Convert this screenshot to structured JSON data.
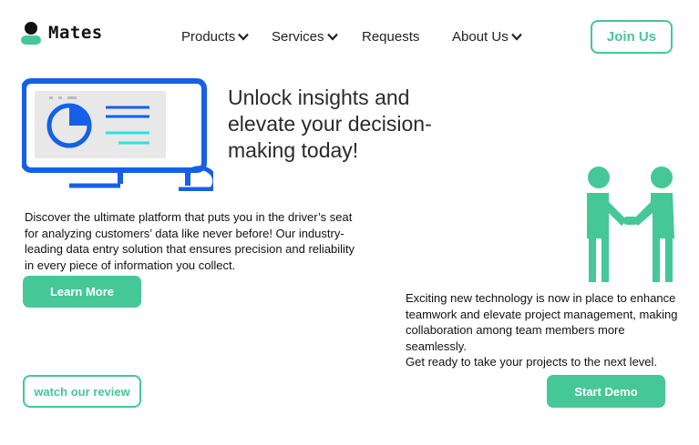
{
  "brand": {
    "name": "Mates",
    "accent": "#45c797",
    "blue": "#1560e8",
    "cyan": "#2ee0e0"
  },
  "nav": {
    "items": [
      {
        "label": "Products",
        "has_dropdown": true
      },
      {
        "label": "Services",
        "has_dropdown": true
      },
      {
        "label": "Requests",
        "has_dropdown": false
      },
      {
        "label": "About Us",
        "has_dropdown": true
      }
    ],
    "join_label": "Join Us"
  },
  "hero": {
    "headline": "Unlock insights and elevate your decision-making today!",
    "description": "Discover the ultimate platform that puts you in the driver’s seat for analyzing customers’ data like never before! Our industry-leading data entry solution that ensures precision and reliability in every piece of information you collect.",
    "learn_more_label": "Learn More",
    "review_label": "watch our review"
  },
  "teamwork": {
    "line1": "Exciting new technology is now in place to enhance teamwork and elevate project management, making collaboration among team members more seamlessly.",
    "line2": "Get ready to take your projects to the next level.",
    "demo_label": "Start Demo"
  },
  "icons": [
    "logo-person-icon",
    "chevron-down-icon",
    "monitor-chart-icon",
    "handshake-icon"
  ]
}
